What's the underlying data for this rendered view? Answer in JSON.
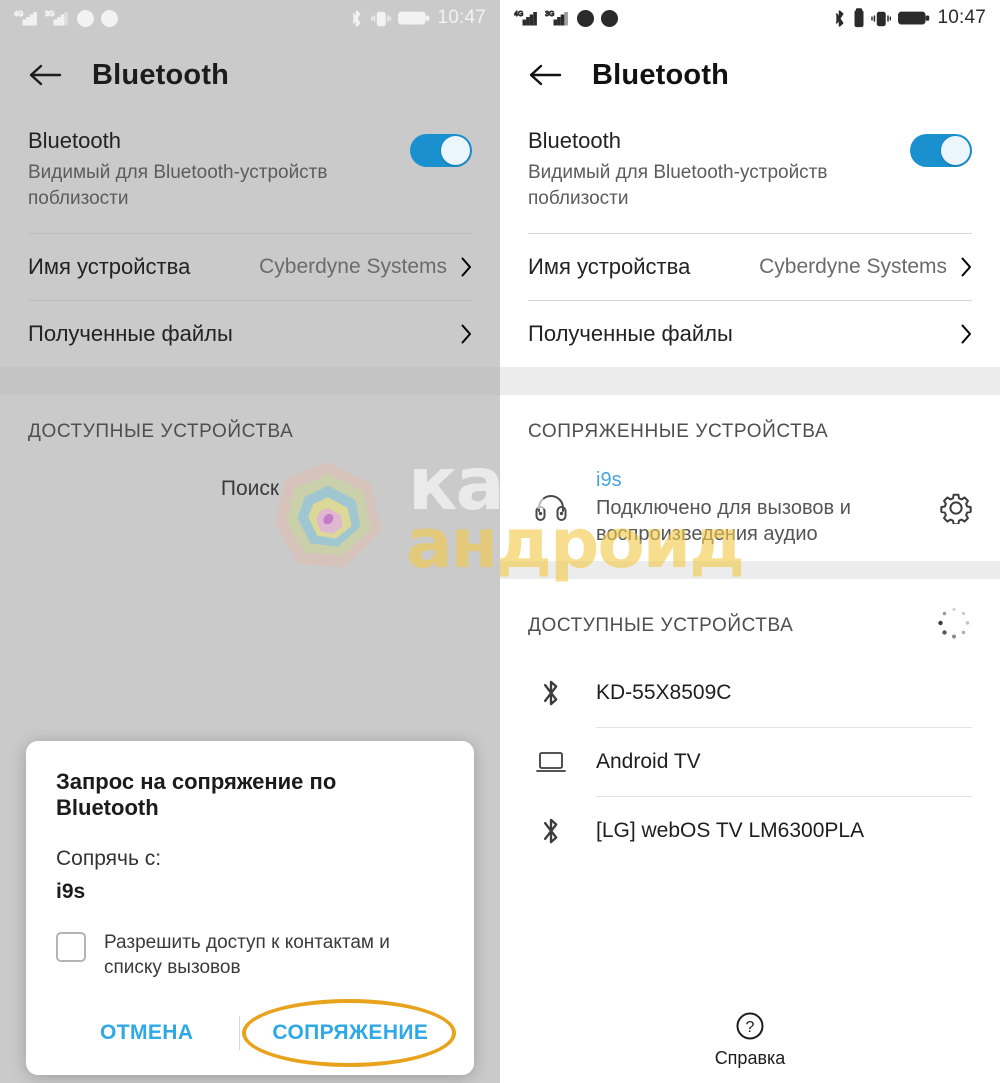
{
  "statusbar": {
    "network_1": "4G",
    "network_2": "3G",
    "time": "10:47",
    "icons": [
      "signal-4g-icon",
      "signal-3g-icon",
      "viber-icon",
      "app-icon",
      "bluetooth-icon",
      "battery-small-icon",
      "vibrate-icon",
      "battery-icon"
    ]
  },
  "left": {
    "appbar": {
      "title": "Bluetooth",
      "back_label": "back-arrow"
    },
    "bluetooth": {
      "title": "Bluetooth",
      "subtitle": "Видимый для Bluetooth-устройств поблизости",
      "toggle_on": true,
      "toggle_color": "#1a90cf"
    },
    "rows": [
      {
        "label": "Имя устройства",
        "value": "Cyberdyne Systems",
        "chevron": true
      },
      {
        "label": "Полученные файлы",
        "value": "",
        "chevron": true
      }
    ],
    "available_header": "ДОСТУПНЫЕ УСТРОЙСТВА",
    "searching_text": "Поиск",
    "help_label": "Справка",
    "dialog": {
      "title": "Запрос на сопряжение по Bluetooth",
      "lead": "Сопрячь с:",
      "device": "i9s",
      "checkbox_label": "Разрешить доступ к контактам и списку вызовов",
      "checkbox_checked": false,
      "cancel_label": "ОТМЕНА",
      "pair_label": "СОПРЯЖЕНИЕ",
      "highlight_color": "#E8A21C",
      "action_color": "#2fa8e8"
    }
  },
  "right": {
    "appbar": {
      "title": "Bluetooth",
      "back_label": "back-arrow"
    },
    "bluetooth": {
      "title": "Bluetooth",
      "subtitle": "Видимый для Bluetooth-устройств поблизости",
      "toggle_on": true,
      "toggle_color": "#1a90cf"
    },
    "rows": [
      {
        "label": "Имя устройства",
        "value": "Cyberdyne Systems",
        "chevron": true
      },
      {
        "label": "Полученные файлы",
        "value": "",
        "chevron": true
      }
    ],
    "paired_header": "СОПРЯЖЕННЫЕ УСТРОЙСТВА",
    "paired_devices": [
      {
        "name": "i9s",
        "status": "Подключено для вызовов и воспроизведения аудио",
        "icon": "headphones-icon",
        "name_color": "#4aa3dd",
        "settings_icon": "gear-icon"
      }
    ],
    "available_header": "ДОСТУПНЫЕ УСТРОЙСТВА",
    "available_devices": [
      {
        "name": "KD-55X8509C",
        "icon": "bluetooth-icon"
      },
      {
        "name": "Android TV",
        "icon": "laptop-icon"
      },
      {
        "name": "[LG] webOS TV LM6300PLA",
        "icon": "bluetooth-icon"
      }
    ],
    "help_label": "Справка"
  },
  "watermark": {
    "line1": "как",
    "line2": "андроид"
  }
}
